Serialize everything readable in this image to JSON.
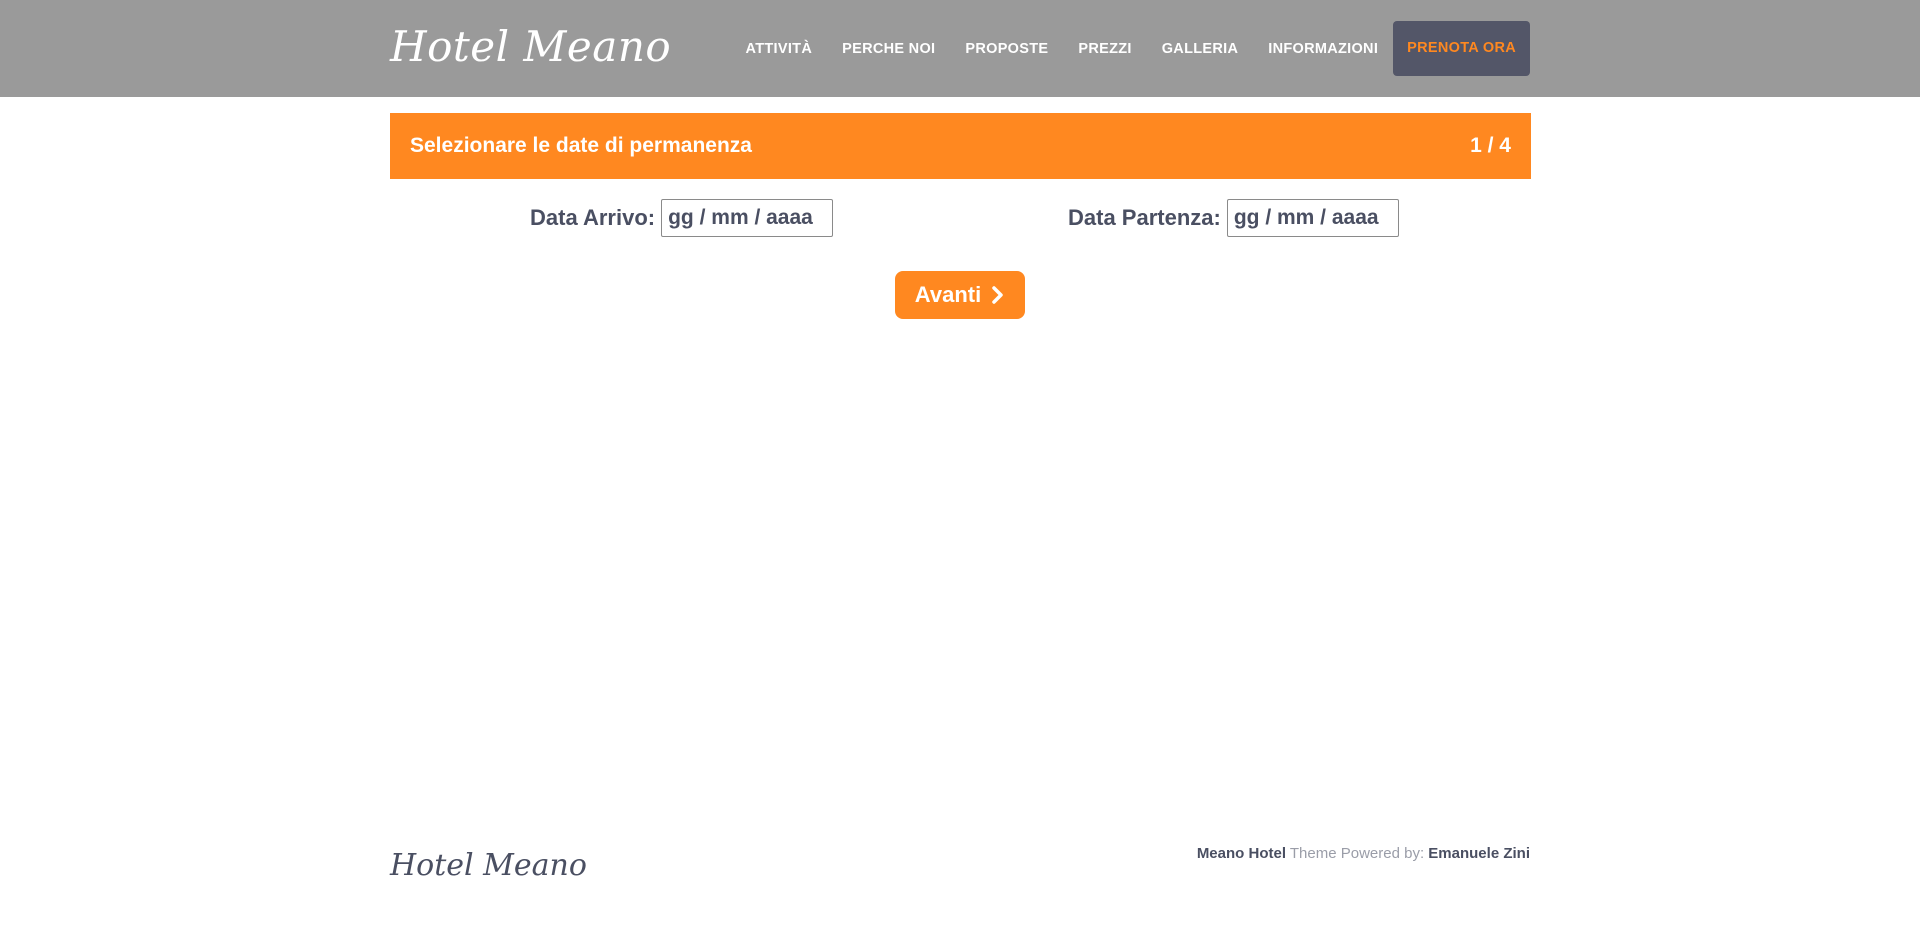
{
  "header": {
    "logo": "Hotel Meano",
    "nav": [
      "ATTIVITÀ",
      "PERCHE NOI",
      "PROPOSTE",
      "PREZZI",
      "GALLERIA",
      "INFORMAZIONI"
    ],
    "book_label": "PRENOTA ORA"
  },
  "booking": {
    "step_title": "Selezionare le date di permanenza",
    "step_counter": "1 / 4",
    "arrival_label": "Data Arrivo:",
    "arrival_placeholder": "gg / mm / aaaa",
    "departure_label": "Data Partenza:",
    "departure_placeholder": "gg / mm / aaaa",
    "next_label": "Avanti",
    "next_icon": "chevron-right-icon"
  },
  "footer": {
    "logo": "Hotel Meano",
    "brand": "Meano Hotel",
    "theme_text": " Theme Powered by: ",
    "author": "Emanuele Zini"
  },
  "colors": {
    "accent": "#ff8820",
    "header_bg": "#9a9a9a",
    "book_bg": "#535668",
    "text": "#4a4f62"
  }
}
